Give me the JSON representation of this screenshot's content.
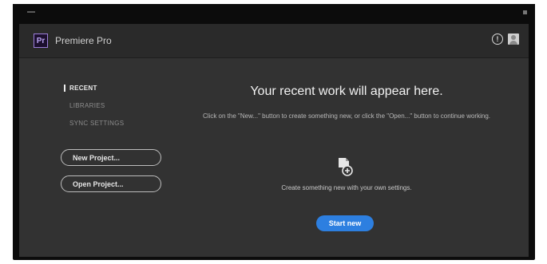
{
  "app": {
    "logo_text": "Pr",
    "title": "Premiere Pro"
  },
  "header": {
    "help_glyph": "!"
  },
  "sidebar": {
    "items": [
      {
        "label": "RECENT",
        "active": true
      },
      {
        "label": "LIBRARIES",
        "active": false
      },
      {
        "label": "SYNC SETTINGS",
        "active": false
      }
    ],
    "new_project_label": "New Project...",
    "open_project_label": "Open Project..."
  },
  "main": {
    "heading": "Your recent work will appear here.",
    "subtext": "Click on the \"New...\" button to create something new, or click the \"Open...\" button to continue working.",
    "create_text": "Create something new with your own settings.",
    "start_label": "Start new"
  },
  "colors": {
    "accent": "#2d7fe0",
    "window_bg": "#323232",
    "logo_border": "#9b7dd9"
  }
}
